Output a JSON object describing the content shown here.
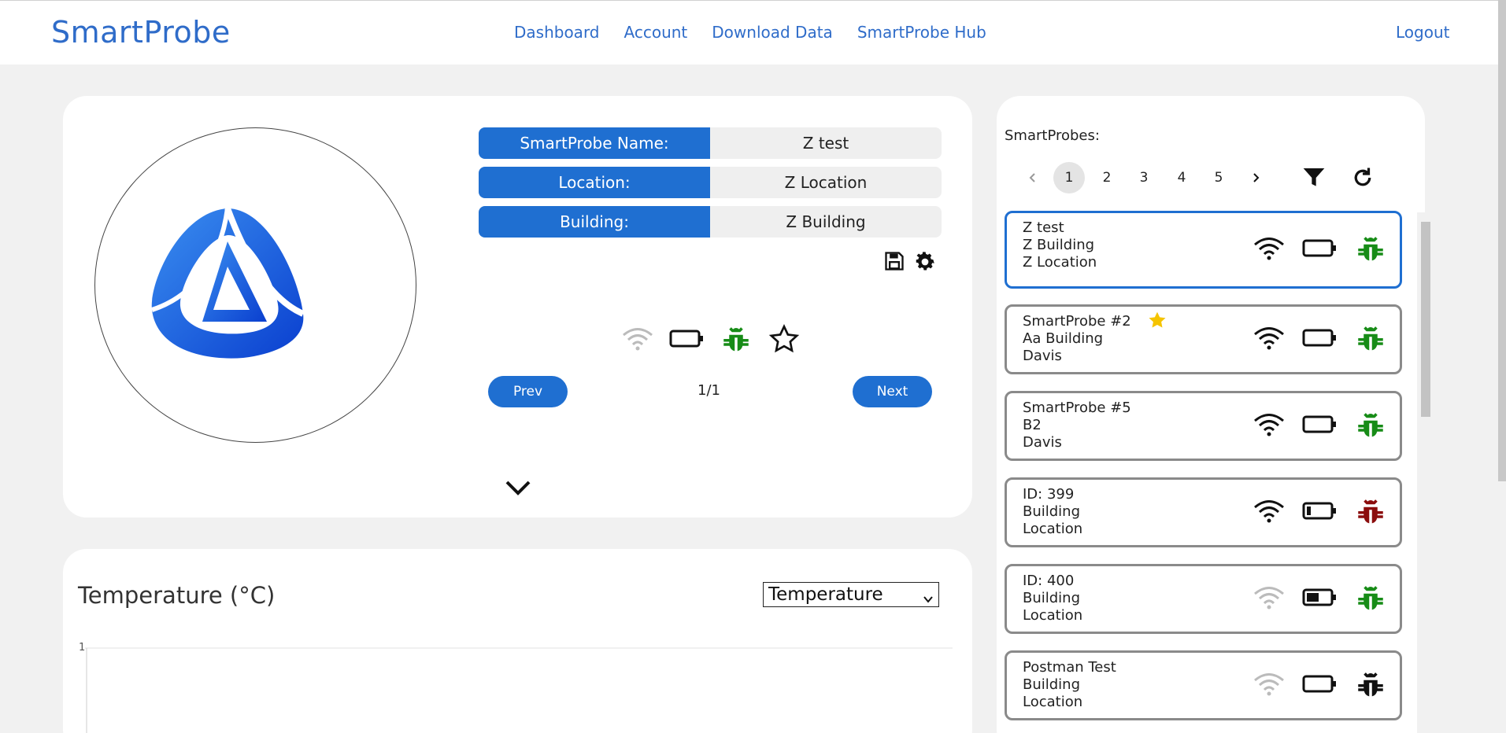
{
  "header": {
    "brand": "SmartProbe",
    "nav": [
      "Dashboard",
      "Account",
      "Download Data",
      "SmartProbe Hub"
    ],
    "logout": "Logout"
  },
  "probe_details": {
    "name_label": "SmartProbe Name:",
    "name_value": "Z test",
    "location_label": "Location:",
    "location_value": "Z Location",
    "building_label": "Building:",
    "building_value": "Z Building",
    "prev_label": "Prev",
    "next_label": "Next",
    "page_indicator": "1/1"
  },
  "chart": {
    "title": "Temperature (°C)",
    "select_value": "Temperature",
    "y_tick": "1"
  },
  "probe_list": {
    "title": "SmartProbes:",
    "pages": [
      "1",
      "2",
      "3",
      "4",
      "5"
    ],
    "active_page": "1",
    "items": [
      {
        "name": "Z test",
        "building": "Z Building",
        "location": "Z Location",
        "wifi": "strong",
        "battery": "empty",
        "bug": "green",
        "starred": false
      },
      {
        "name": "SmartProbe #2",
        "building": "Aa Building",
        "location": "Davis",
        "wifi": "strong",
        "battery": "empty",
        "bug": "green",
        "starred": true
      },
      {
        "name": "SmartProbe #5",
        "building": "B2",
        "location": "Davis",
        "wifi": "strong",
        "battery": "empty",
        "bug": "green",
        "starred": false
      },
      {
        "name": "ID: 399",
        "building": "Building",
        "location": "Location",
        "wifi": "strong",
        "battery": "low",
        "bug": "red",
        "starred": false
      },
      {
        "name": "ID: 400",
        "building": "Building",
        "location": "Location",
        "wifi": "weak",
        "battery": "half",
        "bug": "green",
        "starred": false
      },
      {
        "name": "Postman Test",
        "building": "Building",
        "location": "Location",
        "wifi": "weak",
        "battery": "empty",
        "bug": "black",
        "starred": false
      }
    ]
  },
  "colors": {
    "accent": "#1f6fd1",
    "brand": "#2f6cc9",
    "bug_green": "#178c17",
    "bug_red": "#8b0d0d",
    "bug_black": "#111111",
    "star": "#f5c400"
  }
}
